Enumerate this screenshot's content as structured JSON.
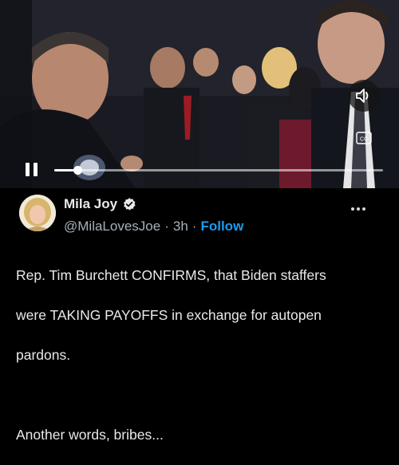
{
  "video": {
    "icons": {
      "volume": "speaker-icon",
      "captions": "closed-captions-icon",
      "pause": "pause-icon"
    },
    "progress_fraction": 0.07
  },
  "post": {
    "author_name": "Mila Joy",
    "handle": "@MilaLovesJoe",
    "separator1": "·",
    "time": "3h",
    "separator2": "·",
    "follow_label": "Follow",
    "text_line1": "Rep. Tim Burchett CONFIRMS, that Biden staffers",
    "text_line2": "were TAKING PAYOFFS in exchange for autopen",
    "text_line3": "pardons.",
    "text_line5": "Another words, bribes..."
  },
  "colors": {
    "accent": "#1d9bf0",
    "verified": "#e8e8e8",
    "background": "#000000"
  }
}
